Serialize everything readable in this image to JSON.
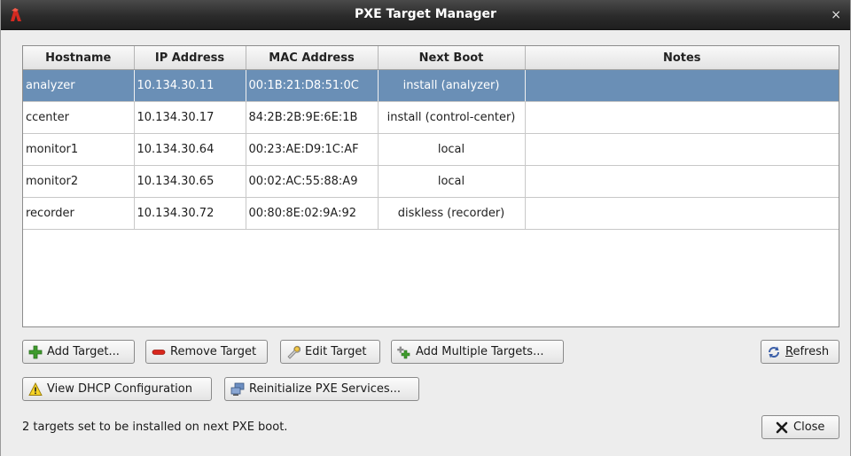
{
  "window": {
    "title": "PXE Target Manager",
    "close_glyph": "×",
    "app_icon": "red-hat-logo-icon"
  },
  "table": {
    "columns": [
      "Hostname",
      "IP Address",
      "MAC Address",
      "Next Boot",
      "Notes"
    ],
    "rows": [
      {
        "hostname": "analyzer",
        "ip": "10.134.30.11",
        "mac": "00:1B:21:D8:51:0C",
        "next_boot": "install (analyzer)",
        "notes": "",
        "selected": true
      },
      {
        "hostname": "ccenter",
        "ip": "10.134.30.17",
        "mac": "84:2B:2B:9E:6E:1B",
        "next_boot": "install (control-center)",
        "notes": "",
        "selected": false
      },
      {
        "hostname": "monitor1",
        "ip": "10.134.30.64",
        "mac": "00:23:AE:D9:1C:AF",
        "next_boot": "local",
        "notes": "",
        "selected": false
      },
      {
        "hostname": "monitor2",
        "ip": "10.134.30.65",
        "mac": "00:02:AC:55:88:A9",
        "next_boot": "local",
        "notes": "",
        "selected": false
      },
      {
        "hostname": "recorder",
        "ip": "10.134.30.72",
        "mac": "00:80:8E:02:9A:92",
        "next_boot": "diskless (recorder)",
        "notes": "",
        "selected": false
      }
    ],
    "selected_color": "#6a8fb6"
  },
  "buttons": {
    "add_target": {
      "label": "Add Target...",
      "icon": "add-plus-icon"
    },
    "remove_target": {
      "label": "Remove Target",
      "icon": "remove-minus-icon"
    },
    "edit_target": {
      "label": "Edit Target",
      "icon": "wrench-icon"
    },
    "add_multiple": {
      "label": "Add Multiple Targets...",
      "icon": "add-multiple-icon"
    },
    "refresh": {
      "label_mnemonic": "R",
      "label_rest": "efresh",
      "icon": "refresh-icon"
    },
    "view_dhcp": {
      "label": "View DHCP Configuration",
      "icon": "warning-icon"
    },
    "reinit_pxe": {
      "label": "Reinitialize PXE Services...",
      "icon": "network-computer-icon"
    },
    "close": {
      "label": "Close",
      "icon": "close-x-icon"
    }
  },
  "status": {
    "text": "2 targets set to be installed on next PXE boot."
  }
}
